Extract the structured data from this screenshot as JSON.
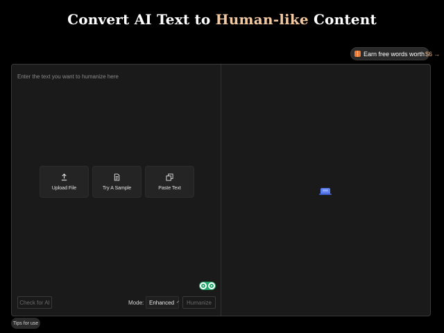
{
  "header": {
    "title_part1": "Convert AI Text to ",
    "title_accent": "Human-like",
    "title_part2": " Content"
  },
  "promo": {
    "text": "Earn free words worth ",
    "amount": "$6",
    "arrow": "→"
  },
  "input": {
    "placeholder": "Enter the text you want to humanize here"
  },
  "actions": [
    {
      "label": "Upload File",
      "icon": "upload-icon"
    },
    {
      "label": "Try A Sample",
      "icon": "document-icon"
    },
    {
      "label": "Paste Text",
      "icon": "copy-icon"
    }
  ],
  "footer": {
    "check_label": "Check for AI",
    "mode_label": "Mode:",
    "mode_value": "Enhanced",
    "humanize_label": "Humanize"
  },
  "tips": {
    "label": "Tips for use"
  },
  "colors": {
    "background": "#000000",
    "panel": "#1a1a1a",
    "accent_title": "#f2c9a1",
    "promo_accent": "#f2b27a",
    "badge_green": "#22a86b",
    "loader_blue": "#5b7ff0"
  }
}
